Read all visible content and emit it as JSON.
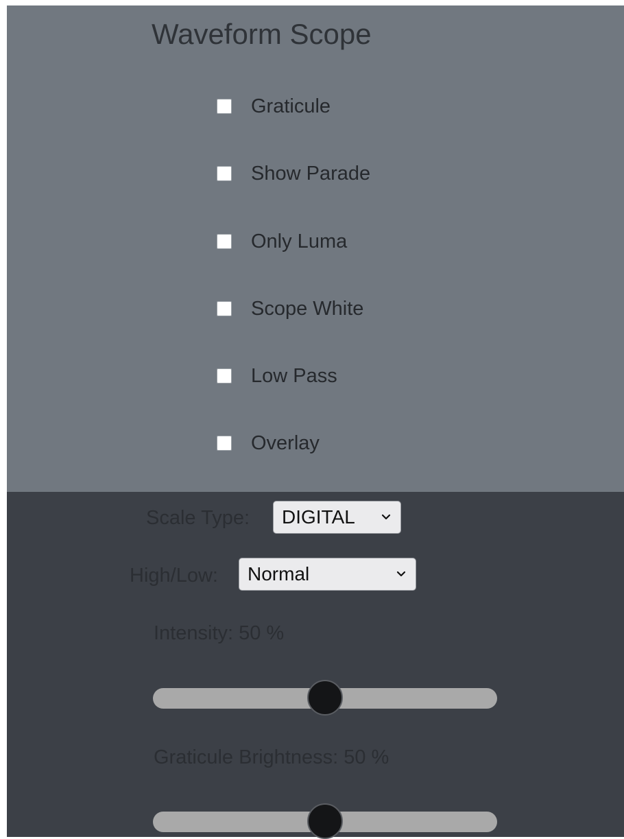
{
  "title": "Waveform Scope",
  "checkboxes": [
    {
      "label": "Graticule",
      "checked": false
    },
    {
      "label": "Show Parade",
      "checked": false
    },
    {
      "label": "Only Luma",
      "checked": false
    },
    {
      "label": "Scope White",
      "checked": false
    },
    {
      "label": "Low Pass",
      "checked": false
    },
    {
      "label": "Overlay",
      "checked": false
    }
  ],
  "scale_type": {
    "label": "Scale Type:",
    "value": "DIGITAL"
  },
  "high_low": {
    "label": "High/Low:",
    "value": "Normal"
  },
  "intensity": {
    "label": "Intensity: 50 %",
    "value": 50
  },
  "graticule_brightness": {
    "label": "Graticule Brightness: 50 %",
    "value": 50
  },
  "icons": {
    "select_arrow": "chevron-down-icon"
  },
  "colors": {
    "top_panel": "#717880",
    "bottom_panel": "#3c4047",
    "slider_track": "#a9a9a9",
    "slider_thumb": "#141517"
  }
}
